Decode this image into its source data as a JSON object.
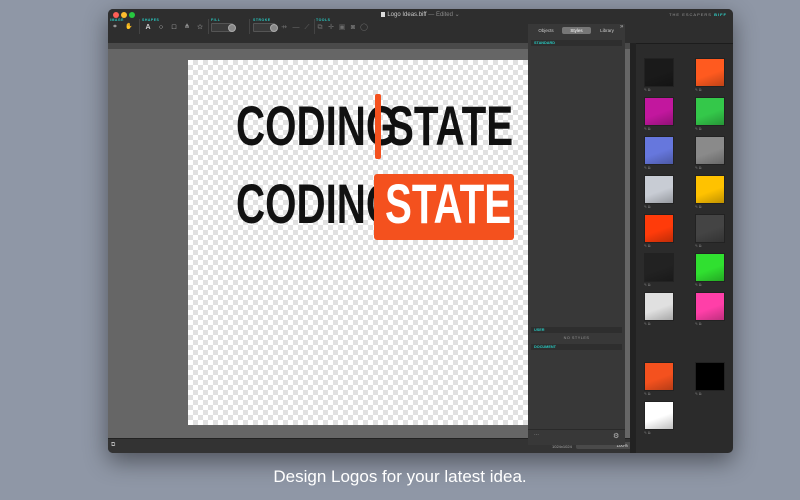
{
  "window": {
    "title": "Logo Ideas.biff",
    "edited": "— Edited ⌄",
    "brand": "THE ESCAPERS",
    "brand_accent": "BIFF"
  },
  "toolbar": {
    "groups": {
      "image": "IMAGE",
      "shapes": "SHAPES",
      "fill": "FILL",
      "stroke": "STROKE",
      "tools": "TOOLS"
    }
  },
  "artwork": {
    "logo1_left": "CODING",
    "logo1_right": "STATE",
    "logo2_left": "CODING",
    "logo2_right": "STATE",
    "accent_color": "#f4511e"
  },
  "status": {
    "canvas_size": "1024x1024",
    "zoom": "100%"
  },
  "panel": {
    "tabs": [
      "Objects",
      "Styles",
      "Library"
    ],
    "active_tab": "Styles",
    "sections": {
      "standard": "STANDARD",
      "user": "USER",
      "document": "DOCUMENT"
    },
    "no_styles": "NO STYLES",
    "standard_styles": [
      {
        "name": "style-black-frame",
        "color": "#1a1a1a"
      },
      {
        "name": "style-orange-dots",
        "color": "#ff5a1f"
      },
      {
        "name": "style-magenta",
        "color": "#c2179e"
      },
      {
        "name": "style-green-radial",
        "color": "#34c84a"
      },
      {
        "name": "style-blue-gradient",
        "color": "#6677dd"
      },
      {
        "name": "style-gray-gradient",
        "color": "#8a8a8a"
      },
      {
        "name": "style-light-gradient",
        "color": "#c8ccd4"
      },
      {
        "name": "style-yellow-orange",
        "color": "#ffc200"
      },
      {
        "name": "style-red-radial",
        "color": "#ff3b0a"
      },
      {
        "name": "style-metal-gradient",
        "color": "#444444"
      },
      {
        "name": "style-dark-gradient",
        "color": "#222222"
      },
      {
        "name": "style-green",
        "color": "#30e030"
      },
      {
        "name": "style-white-gradient",
        "color": "#e0e0e0"
      },
      {
        "name": "style-pink-dots",
        "color": "#ff3fa8"
      }
    ],
    "document_styles": [
      {
        "name": "doc-orange",
        "color": "#f4511e"
      },
      {
        "name": "doc-black",
        "color": "#000000"
      },
      {
        "name": "doc-white",
        "color": "#ffffff"
      }
    ]
  },
  "caption": "Design Logos for your latest idea."
}
